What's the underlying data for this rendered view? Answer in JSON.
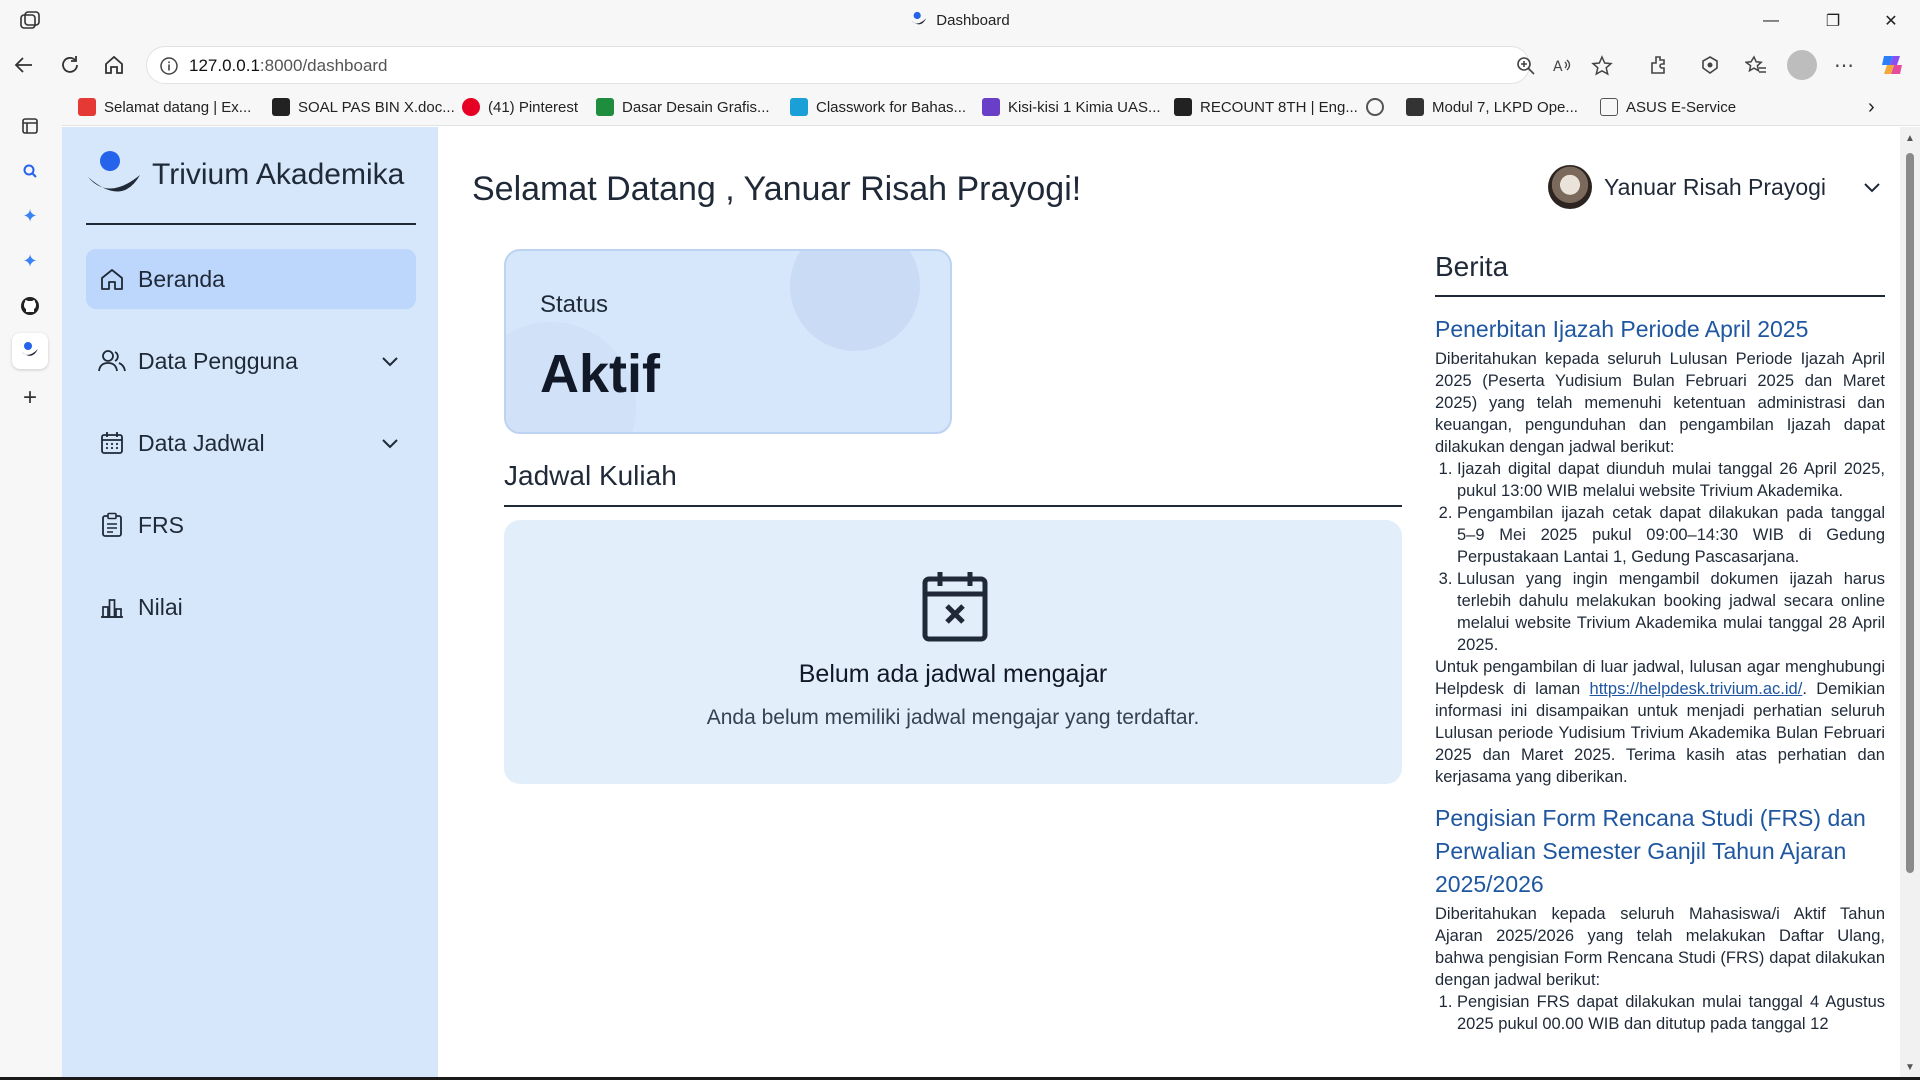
{
  "browser": {
    "tab_title": "Dashboard",
    "url_host": "127.0.0.1",
    "url_path": ":8000/dashboard",
    "bookmarks": [
      {
        "label": "Selamat datang | Ex...",
        "color": "#e53935"
      },
      {
        "label": "SOAL PAS BIN X.doc...",
        "color": "#222222"
      },
      {
        "label": "(41) Pinterest",
        "color": "#e60023"
      },
      {
        "label": "Dasar Desain Grafis...",
        "color": "#1e8e3e"
      },
      {
        "label": "Classwork for Bahas...",
        "color": "#1a9fd6"
      },
      {
        "label": "Kisi-kisi 1 Kimia UAS...",
        "color": "#6a3fc7"
      },
      {
        "label": "RECOUNT 8TH | Eng...",
        "color": "#222222"
      },
      {
        "label": "",
        "color": "#555555"
      },
      {
        "label": "Modul 7, LKPD Ope...",
        "color": "#333333"
      },
      {
        "label": "ASUS E-Service",
        "color": "#555555"
      }
    ]
  },
  "app": {
    "brand": "Trivium Akademika",
    "menu": [
      {
        "label": "Beranda",
        "icon": "home-icon",
        "active": true
      },
      {
        "label": "Data Pengguna",
        "icon": "users-icon",
        "expandable": true
      },
      {
        "label": "Data Jadwal",
        "icon": "calendar-icon",
        "expandable": true
      },
      {
        "label": "FRS",
        "icon": "clipboard-icon"
      },
      {
        "label": "Nilai",
        "icon": "chart-icon"
      }
    ],
    "greeting": "Selamat Datang , Yanuar Risah Prayogi!",
    "user_name": "Yanuar Risah Prayogi",
    "status": {
      "label": "Status",
      "value": "Aktif"
    },
    "schedule": {
      "title": "Jadwal Kuliah",
      "empty_title": "Belum ada jadwal mengajar",
      "empty_desc": "Anda belum memiliki jadwal mengajar yang terdaftar."
    },
    "news": {
      "title": "Berita",
      "articles": [
        {
          "title": "Penerbitan Ijazah Periode April 2025",
          "intro": "Diberitahukan kepada seluruh Lulusan Periode Ijazah April 2025 (Peserta Yudisium Bulan Februari 2025 dan Maret 2025) yang telah memenuhi ketentuan administrasi dan keuangan, pengunduhan dan pengambilan Ijazah dapat dilakukan dengan jadwal berikut:",
          "items": [
            "Ijazah digital dapat diunduh mulai tanggal 26 April 2025, pukul 13:00 WIB melalui website Trivium Akademika.",
            "Pengambilan ijazah cetak dapat dilakukan pada tanggal 5–9 Mei 2025 pukul 09:00–14:30 WIB di Gedung Perpustakaan Lantai 1, Gedung Pascasarjana.",
            "Lulusan yang ingin mengambil dokumen ijazah harus terlebih dahulu melakukan booking jadwal secara online melalui website Trivium Akademika mulai tanggal 28 April 2025."
          ],
          "outro_before": "Untuk pengambilan di luar jadwal, lulusan agar menghubungi Helpdesk di laman ",
          "link": "https://helpdesk.trivium.ac.id/",
          "outro_after": ". Demikian informasi ini disampaikan untuk menjadi perhatian seluruh Lulusan periode Yudisium Trivium Akademika Bulan Februari 2025 dan Maret 2025. Terima kasih atas perhatian dan kerjasama yang diberikan."
        },
        {
          "title": "Pengisian Form Rencana Studi (FRS) dan Perwalian Semester Ganjil Tahun Ajaran 2025/2026",
          "intro": "Diberitahukan kepada seluruh Mahasiswa/i Aktif Tahun Ajaran 2025/2026 yang telah melakukan Daftar Ulang, bahwa pengisian Form Rencana Studi (FRS) dapat dilakukan dengan jadwal berikut:",
          "items": [
            "Pengisian FRS dapat dilakukan mulai tanggal 4 Agustus 2025 pukul 00.00 WIB dan ditutup pada tanggal 12"
          ]
        }
      ]
    }
  },
  "colors": {
    "sidebar_bg": "#d7e7fb",
    "active_item": "#bcd7fb",
    "card_bg": "#d6e6fb",
    "empty_bg": "#e3eefb",
    "link": "#1e56a0"
  }
}
